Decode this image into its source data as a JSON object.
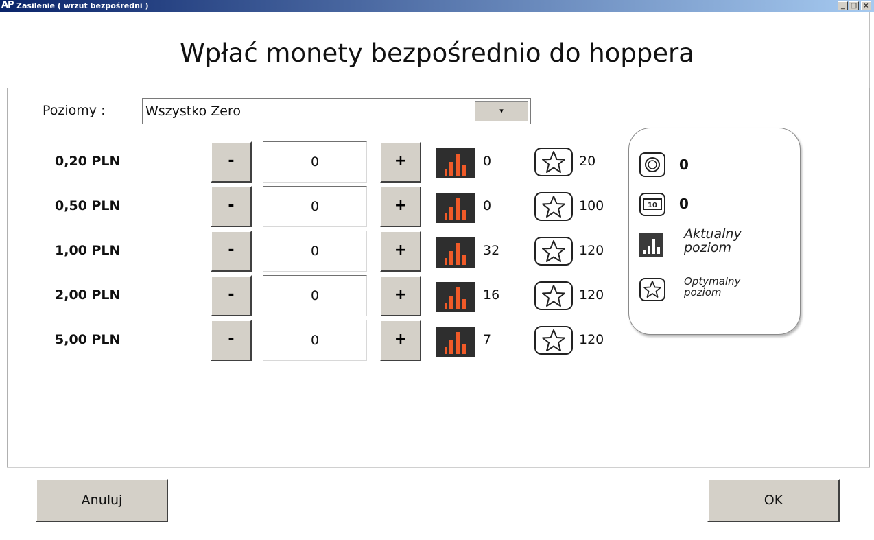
{
  "window": {
    "logo": "AP",
    "title": "Zasilenie ( wrzut bezpośredni )",
    "minimize": "_",
    "maximize": "□",
    "close": "×"
  },
  "heading": "Wpłać monety bezpośrednio do hoppera",
  "levels": {
    "label": "Poziomy :",
    "selected": "Wszystko Zero",
    "dropdown_arrow": "▾"
  },
  "rows": [
    {
      "denomination": "0,20 PLN",
      "minus": "-",
      "plus": "+",
      "quantity": "0",
      "current": "0",
      "optimal": "20"
    },
    {
      "denomination": "0,50 PLN",
      "minus": "-",
      "plus": "+",
      "quantity": "0",
      "current": "0",
      "optimal": "100"
    },
    {
      "denomination": "1,00 PLN",
      "minus": "-",
      "plus": "+",
      "quantity": "0",
      "current": "32",
      "optimal": "120"
    },
    {
      "denomination": "2,00 PLN",
      "minus": "-",
      "plus": "+",
      "quantity": "0",
      "current": "16",
      "optimal": "120"
    },
    {
      "denomination": "5,00 PLN",
      "minus": "-",
      "plus": "+",
      "quantity": "0",
      "current": "7",
      "optimal": "120"
    }
  ],
  "legend": {
    "coin_total": "0",
    "note_icon_label": "10",
    "note_total": "0",
    "current_level": [
      "Aktualny",
      "poziom"
    ],
    "optimal_level": [
      "Optymalny",
      "poziom"
    ]
  },
  "buttons": {
    "cancel": "Anuluj",
    "ok": "OK"
  },
  "colors": {
    "bar_icon_bg": "#2e2e2e",
    "bar_icon_bars": "#f05a28",
    "button_face": "#d4d0c8",
    "title_bar": "#0a246a"
  }
}
